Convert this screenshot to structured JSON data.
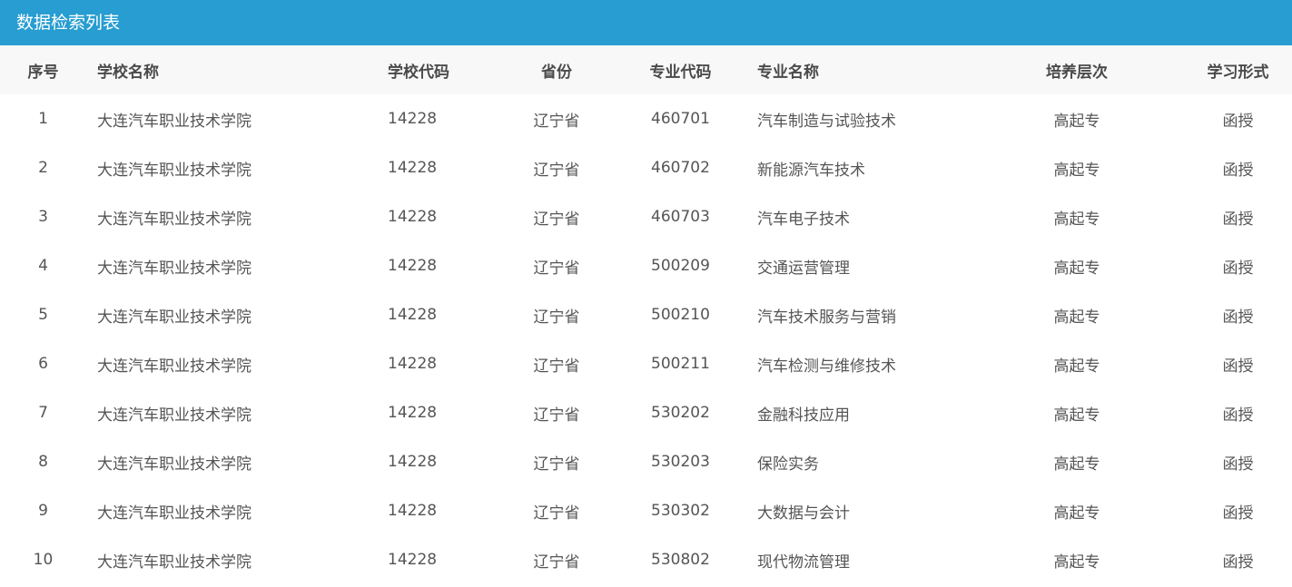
{
  "panel": {
    "title": "数据检索列表"
  },
  "table": {
    "columns": [
      "序号",
      "学校名称",
      "学校代码",
      "省份",
      "专业代码",
      "专业名称",
      "培养层次",
      "学习形式"
    ],
    "rows": [
      [
        "1",
        "大连汽车职业技术学院",
        "14228",
        "辽宁省",
        "460701",
        "汽车制造与试验技术",
        "高起专",
        "函授"
      ],
      [
        "2",
        "大连汽车职业技术学院",
        "14228",
        "辽宁省",
        "460702",
        "新能源汽车技术",
        "高起专",
        "函授"
      ],
      [
        "3",
        "大连汽车职业技术学院",
        "14228",
        "辽宁省",
        "460703",
        "汽车电子技术",
        "高起专",
        "函授"
      ],
      [
        "4",
        "大连汽车职业技术学院",
        "14228",
        "辽宁省",
        "500209",
        "交通运营管理",
        "高起专",
        "函授"
      ],
      [
        "5",
        "大连汽车职业技术学院",
        "14228",
        "辽宁省",
        "500210",
        "汽车技术服务与营销",
        "高起专",
        "函授"
      ],
      [
        "6",
        "大连汽车职业技术学院",
        "14228",
        "辽宁省",
        "500211",
        "汽车检测与维修技术",
        "高起专",
        "函授"
      ],
      [
        "7",
        "大连汽车职业技术学院",
        "14228",
        "辽宁省",
        "530202",
        "金融科技应用",
        "高起专",
        "函授"
      ],
      [
        "8",
        "大连汽车职业技术学院",
        "14228",
        "辽宁省",
        "530203",
        "保险实务",
        "高起专",
        "函授"
      ],
      [
        "9",
        "大连汽车职业技术学院",
        "14228",
        "辽宁省",
        "530302",
        "大数据与会计",
        "高起专",
        "函授"
      ],
      [
        "10",
        "大连汽车职业技术学院",
        "14228",
        "辽宁省",
        "530802",
        "现代物流管理",
        "高起专",
        "函授"
      ]
    ]
  },
  "colors": {
    "header_bg": "#279dd1",
    "thead_bg": "#f8f8f8",
    "text": "#555555"
  }
}
